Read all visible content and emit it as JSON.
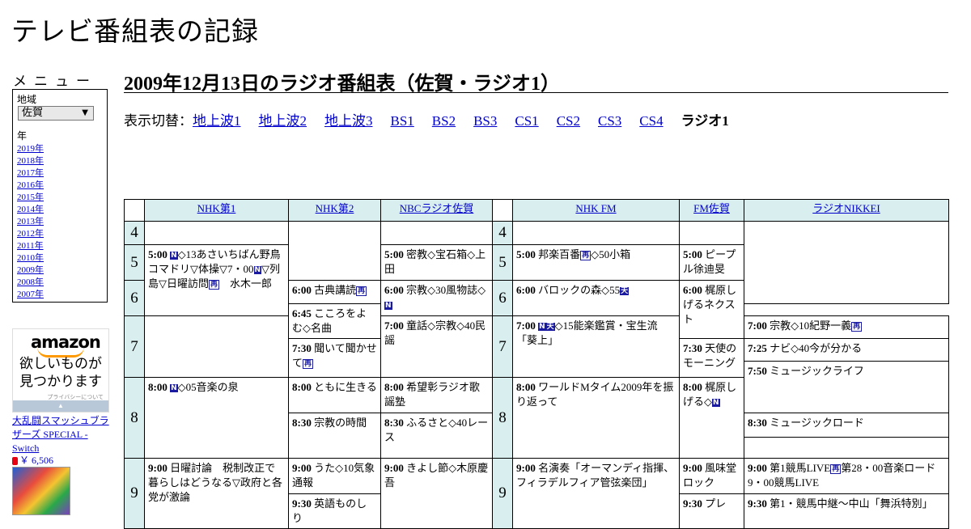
{
  "site_title": "テレビ番組表の記録",
  "menu": {
    "heading": "メニュー",
    "region_label": "地域",
    "region_value": "佐賀",
    "year_label": "年",
    "years": [
      "2019年",
      "2018年",
      "2017年",
      "2016年",
      "2015年",
      "2014年",
      "2013年",
      "2012年",
      "2011年",
      "2010年",
      "2009年",
      "2008年",
      "2007年"
    ]
  },
  "ad": {
    "brand": "amazon",
    "copy_line1": "欲しいものが",
    "copy_line2": "見つかります",
    "privacy": "プライバシーについて",
    "product_title": "大乱闘スマッシュブラザーズ SPECIAL - Switch",
    "product_price": "￥ 6,506"
  },
  "page_title": "2009年12月13日のラジオ番組表（佐賀・ラジオ1）",
  "switch": {
    "label": "表示切替：",
    "links": [
      "地上波1",
      "地上波2",
      "地上波3",
      "BS1",
      "BS2",
      "BS3",
      "CS1",
      "CS2",
      "CS3",
      "CS4"
    ],
    "current": "ラジオ1"
  },
  "grid": {
    "channels": [
      "NHK第1",
      "NHK第2",
      "NBCラジオ佐賀",
      "NHK FM",
      "FM佐賀",
      "ラジオNIKKEI"
    ],
    "hours": [
      "4",
      "5",
      "6",
      "7",
      "8",
      "9"
    ],
    "programs": {
      "nhk1_500_time": "5:00",
      "nhk1_500_text": "◇13あさいちばん野鳥コマドリ▽体操▽7・00",
      "nhk1_500_text2": "▽列島▽日曜訪問",
      "nhk1_500_text3": "　水木一郎",
      "nhk1_800_time": "8:00",
      "nhk1_800_text": "◇05音楽の泉",
      "nhk1_900_time": "9:00",
      "nhk1_900_text": "日曜討論　税制改正で暮らしはどうなる▽政府と各党が激論",
      "nhk2_600_time": "6:00",
      "nhk2_600_text": "古典講読",
      "nhk2_645_time": "6:45",
      "nhk2_645_text": "こころをよむ◇名曲",
      "nhk2_730_time": "7:30",
      "nhk2_730_text": "聞いて聞かせて",
      "nhk2_800_time": "8:00",
      "nhk2_800_text": "ともに生きる",
      "nhk2_830_time": "8:30",
      "nhk2_830_text": "宗教の時間",
      "nhk2_900_time": "9:00",
      "nhk2_900_text": "うた◇10気象通報",
      "nhk2_930_time": "9:30",
      "nhk2_930_text": "英語ものしり",
      "nbc_500_time": "5:00",
      "nbc_500_text": "密教◇宝石箱◇上田",
      "nbc_600_time": "6:00",
      "nbc_600_text": "宗教◇30風物誌◇",
      "nbc_700_time": "7:00",
      "nbc_700_text": "童話◇宗教◇40民謡",
      "nbc_800_time": "8:00",
      "nbc_800_text": "希望彰ラジオ歌謡塾",
      "nbc_830_time": "8:30",
      "nbc_830_text": "ふるさと◇40レース",
      "nbc_900_time": "9:00",
      "nbc_900_text": "きよし節◇木原慶吾",
      "fm_500_time": "5:00",
      "fm_500_text": "邦楽百番",
      "fm_500_text2": "◇50小箱",
      "fm_600_time": "6:00",
      "fm_600_text": "バロックの森◇55",
      "fm_700_time": "7:00",
      "fm_700_text": "◇15能楽鑑賞・宝生流「葵上」",
      "fm_800_time": "8:00",
      "fm_800_text": "ワールドMタイム2009年を振り返って",
      "fm_900_time": "9:00",
      "fm_900_text": "名演奏「オーマンディ指揮、フィラデルフィア管弦楽団」",
      "fms_500_time": "5:00",
      "fms_500_text": "ピープル徐迪旻",
      "fms_600_time": "6:00",
      "fms_600_text": "梶原しげるネクスト",
      "fms_730_time": "7:30",
      "fms_730_text": "天使のモーニング",
      "fms_800_time": "8:00",
      "fms_800_text": "梶原しげる◇",
      "fms_900_time": "9:00",
      "fms_900_text": "風味堂ロック",
      "fms_930_time": "9:30",
      "fms_930_text": "プレ",
      "nik_700_time": "7:00",
      "nik_700_text": "宗教◇10紀野一義",
      "nik_725_time": "7:25",
      "nik_725_text": "ナビ◇40今が分かる",
      "nik_750_time": "7:50",
      "nik_750_text": "ミュージックライフ",
      "nik_830_time": "8:30",
      "nik_830_text": "ミュージックロード",
      "nik_900_time": "9:00",
      "nik_900_text": "第1競馬LIVE",
      "nik_900_text2": "第28・00音楽ロード9・00競馬LIVE",
      "nik_930_time": "9:30",
      "nik_930_text": "第1・競馬中継～中山「舞浜特別」"
    },
    "icons": {
      "news": "N",
      "rerun": "再",
      "weather": "天"
    }
  }
}
